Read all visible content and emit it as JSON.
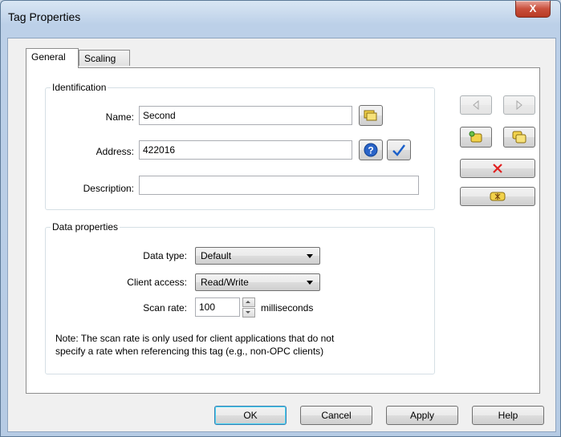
{
  "window": {
    "title": "Tag Properties",
    "close_glyph": "X"
  },
  "tabs": [
    {
      "label": "General"
    },
    {
      "label": "Scaling"
    }
  ],
  "identification": {
    "legend": "Identification",
    "name_label": "Name:",
    "name_value": "Second",
    "address_label": "Address:",
    "address_value": "422016",
    "description_label": "Description:",
    "description_value": ""
  },
  "data_properties": {
    "legend": "Data properties",
    "data_type_label": "Data type:",
    "data_type_value": "Default",
    "client_access_label": "Client access:",
    "client_access_value": "Read/Write",
    "scan_rate_label": "Scan rate:",
    "scan_rate_value": "100",
    "scan_rate_unit": "milliseconds",
    "note_line1": "Note: The scan rate is only used for client applications that do not",
    "note_line2": "specify a rate when referencing this tag (e.g., non-OPC clients)"
  },
  "side_buttons": {
    "prev_icon": "triangle-left-icon",
    "next_icon": "triangle-right-icon",
    "new_tag_icon": "new-tag-icon",
    "duplicate_tag_icon": "duplicate-tag-icon",
    "delete_icon": "red-x-icon",
    "apply_icon": "tag-apply-icon"
  },
  "footer": {
    "ok": "OK",
    "cancel": "Cancel",
    "apply": "Apply",
    "help": "Help"
  },
  "colors": {
    "delete_red": "#e02020",
    "check_blue": "#1a5fc9",
    "help_blue": "#2a64c8",
    "tag_yellow": "#f2d24a"
  }
}
